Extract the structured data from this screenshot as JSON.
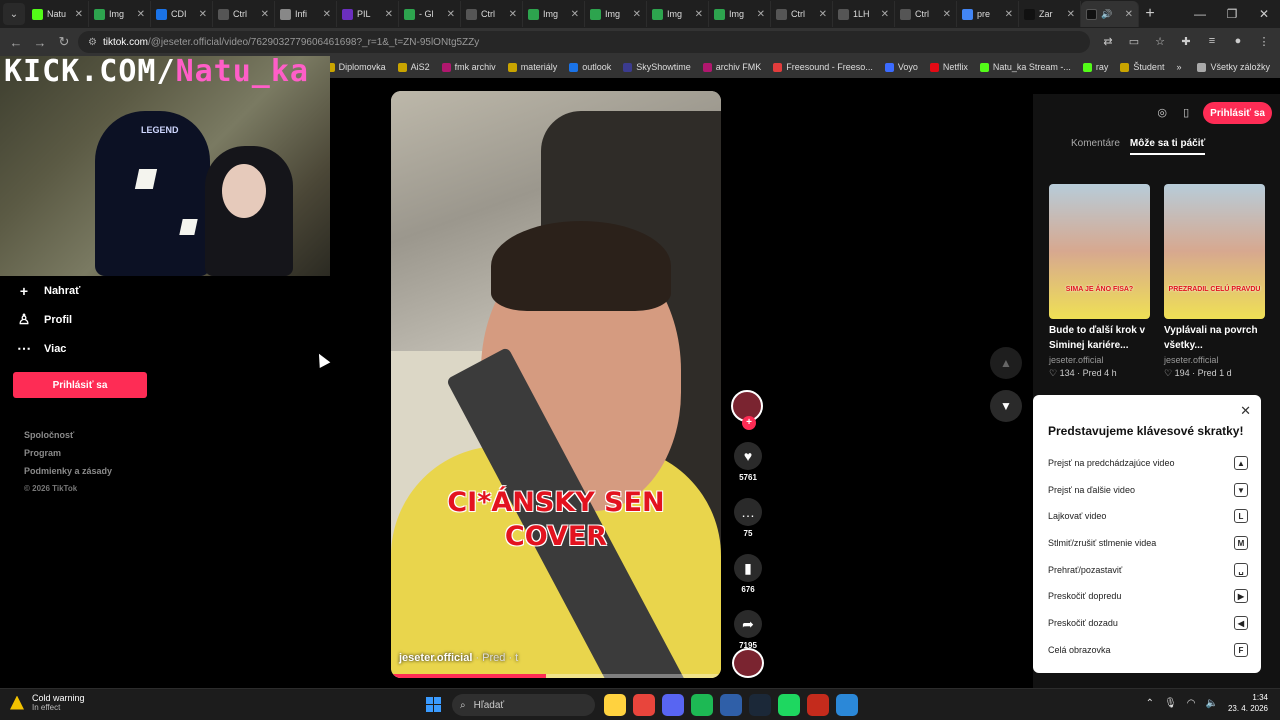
{
  "browser": {
    "tabs": [
      {
        "label": "Natu",
        "color": "#53fc18"
      },
      {
        "label": "Img",
        "color": "#2da44e"
      },
      {
        "label": "CDI",
        "color": "#1a73e8"
      },
      {
        "label": "Ctrl",
        "color": "#555555"
      },
      {
        "label": "Infi",
        "color": "#888888"
      },
      {
        "label": "PIL",
        "color": "#6b2fbf"
      },
      {
        "label": "- Gl",
        "color": "#2da44e"
      },
      {
        "label": "Ctrl",
        "color": "#555555"
      },
      {
        "label": "Img",
        "color": "#2da44e"
      },
      {
        "label": "Img",
        "color": "#2da44e"
      },
      {
        "label": "Img",
        "color": "#2da44e"
      },
      {
        "label": "Img",
        "color": "#2da44e"
      },
      {
        "label": "Ctrl",
        "color": "#555555"
      },
      {
        "label": "1LH",
        "color": "#555555"
      },
      {
        "label": "Ctrl",
        "color": "#555555"
      },
      {
        "label": "pre",
        "color": "#4285f4"
      },
      {
        "label": "Zar",
        "color": "#111111"
      }
    ],
    "url_host": "tiktok.com",
    "url_path": "/@jeseter.official/video/7629032779606461698?_r=1&_t=ZN-95lONtg5ZZy",
    "bookmarks": [
      {
        "label": "Diplomovka",
        "color": "#c9a400"
      },
      {
        "label": "AiS2",
        "color": "#c9a400"
      },
      {
        "label": "fmk archiv",
        "color": "#b0176e"
      },
      {
        "label": "materiály",
        "color": "#c9a400"
      },
      {
        "label": "outlook",
        "color": "#1a73e8"
      },
      {
        "label": "SkyShowtime",
        "color": "#3b3b8f"
      },
      {
        "label": "archiv FMK",
        "color": "#b0176e"
      },
      {
        "label": "Freesound - Freeso...",
        "color": "#e23c3c"
      },
      {
        "label": "Voyo",
        "color": "#3b6bff"
      },
      {
        "label": "Netflix",
        "color": "#e50914"
      },
      {
        "label": "Natu_ka Stream -...",
        "color": "#53fc18"
      },
      {
        "label": "ray",
        "color": "#53fc18"
      },
      {
        "label": "Študent",
        "color": "#c9a400"
      }
    ],
    "bookmarks_chevron": "»",
    "bookmarks_all": "Všetky záložky"
  },
  "overlay": {
    "prefix": "KICK.COM/",
    "handle": "Natu_ka",
    "chair_logo": "LEGEND"
  },
  "sidebar": {
    "items": [
      {
        "label": "Nahrať",
        "icon": "+"
      },
      {
        "label": "Profil",
        "icon": "♙"
      },
      {
        "label": "Viac",
        "icon": "⋯"
      }
    ],
    "login": "Prihlásiť sa",
    "footer": [
      "Spoločnosť",
      "Program",
      "Podmienky a zásady"
    ],
    "copyright": "© 2026 TikTok"
  },
  "video": {
    "caption_line1": "CI*ÁNSKY SEN",
    "caption_line2": "COVER",
    "author": "jeseter.official",
    "date_prefix": "· Pred · t",
    "progress": 0.47
  },
  "actions": {
    "likes": "5761",
    "comments": "75",
    "saves": "676",
    "shares": "7195"
  },
  "right_panel": {
    "login": "Prihlásiť sa",
    "tab_comments": "Komentáre",
    "tab_suggested": "Môže sa ti páčiť",
    "cards": [
      {
        "title": "Bude to ďalší krok v Siminej kariére...",
        "author": "jeseter.official",
        "likes": "134",
        "time": "Pred 4 h",
        "thumb_caption": "SIMA JE ÁNO FISA?"
      },
      {
        "title": "Vyplávali na povrch všetky...",
        "author": "jeseter.official",
        "likes": "194",
        "time": "Pred 1 d",
        "thumb_caption": "PREZRADIL CELÚ PRAVDU"
      }
    ]
  },
  "shortcuts": {
    "title": "Predstavujeme klávesové skratky!",
    "items": [
      {
        "label": "Prejsť na predchádzajúce video",
        "key": "▲"
      },
      {
        "label": "Prejsť na ďalšie video",
        "key": "▼"
      },
      {
        "label": "Lajkovať video",
        "key": "L"
      },
      {
        "label": "Stlmiť/zrušiť stlmenie videa",
        "key": "M"
      },
      {
        "label": "Prehrať/pozastaviť",
        "key": "␣"
      },
      {
        "label": "Preskočiť dopredu",
        "key": "▶"
      },
      {
        "label": "Preskočiť dozadu",
        "key": "◀"
      },
      {
        "label": "Celá obrazovka",
        "key": "F"
      }
    ]
  },
  "taskbar": {
    "weather_title": "Cold warning",
    "weather_sub": "In effect",
    "search_placeholder": "Hľadať",
    "time": "1:34",
    "date": "23. 4. 2026",
    "apps": [
      "#ffd23f",
      "#e8453c",
      "#5865f2",
      "#1db954",
      "#2f5fa8",
      "#1b2838",
      "#1ed760",
      "#c42b1c",
      "#2b88d8"
    ]
  },
  "colors": {
    "accent": "#fe2c55"
  }
}
